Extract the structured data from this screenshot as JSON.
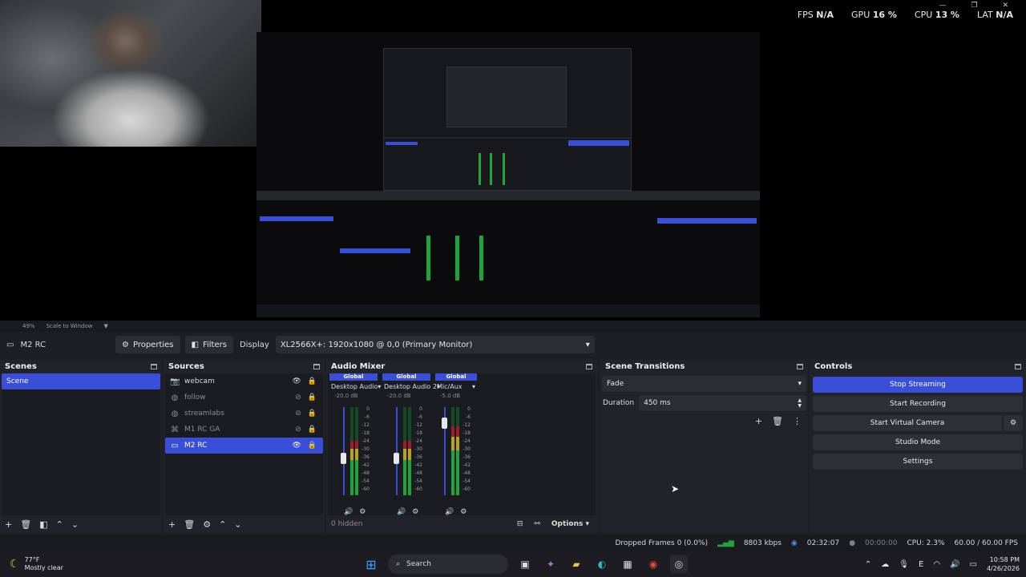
{
  "hud": {
    "fps_label": "FPS",
    "fps_value": "N/A",
    "gpu_label": "GPU",
    "gpu_value": "16 %",
    "cpu_label": "CPU",
    "cpu_value": "13 %",
    "lat_label": "LAT",
    "lat_value": "N/A"
  },
  "scale_row": {
    "zoom": "49%",
    "mode": "Scale to Window"
  },
  "context": {
    "source_name": "M2 RC",
    "properties_label": "Properties",
    "filters_label": "Filters",
    "display_label": "Display",
    "display_value": "XL2566X+: 1920x1080 @ 0,0 (Primary Monitor)"
  },
  "scenes": {
    "title": "Scenes",
    "items": [
      {
        "label": "Scene",
        "selected": true
      }
    ]
  },
  "sources": {
    "title": "Sources",
    "items": [
      {
        "label": "webcam",
        "icon": "camera-icon",
        "visible": true
      },
      {
        "label": "follow",
        "icon": "globe-icon",
        "visible": false
      },
      {
        "label": "streamlabs",
        "icon": "globe-icon",
        "visible": false
      },
      {
        "label": "M1 RC GA",
        "icon": "gamepad-icon",
        "visible": false
      },
      {
        "label": "M2 RC",
        "icon": "monitor-icon",
        "visible": true,
        "selected": true
      }
    ]
  },
  "audio_mixer": {
    "title": "Audio Mixer",
    "channels": [
      {
        "badge": "Global",
        "name": "Desktop Audio",
        "db": "-20.0 dB",
        "level": 0.62,
        "fader": 0.42
      },
      {
        "badge": "Global",
        "name": "Desktop Audio 2",
        "db": "-20.0 dB",
        "level": 0.62,
        "fader": 0.42
      },
      {
        "badge": "Global",
        "name": "Mic/Aux",
        "db": "-5.0 dB",
        "level": 0.78,
        "fader": 0.82
      }
    ],
    "scale_ticks": [
      "0",
      "-6",
      "-12",
      "-18",
      "-24",
      "-30",
      "-36",
      "-42",
      "-48",
      "-54",
      "-60"
    ],
    "hidden_label": "0 hidden",
    "options_label": "Options"
  },
  "transitions": {
    "title": "Scene Transitions",
    "transition": "Fade",
    "duration_label": "Duration",
    "duration_value": "450 ms"
  },
  "controls": {
    "title": "Controls",
    "stop_streaming": "Stop Streaming",
    "start_recording": "Start Recording",
    "start_virtual_camera": "Start Virtual Camera",
    "studio_mode": "Studio Mode",
    "settings": "Settings"
  },
  "status": {
    "dropped_frames": "Dropped Frames 0 (0.0%)",
    "bitrate": "8803 kbps",
    "stream_time": "02:32:07",
    "record_time": "00:00:00",
    "cpu": "CPU: 2.3%",
    "fps": "60.00 / 60.00 FPS"
  },
  "taskbar": {
    "temp": "77°F",
    "weather": "Mostly clear",
    "search_placeholder": "Search",
    "time": "10:58 PM",
    "date": "4/26/2026"
  },
  "colors": {
    "accent": "#3a4fd8",
    "meter_green": "#1fa43b",
    "meter_yellow": "#b9a417",
    "meter_red": "#9e1d2b"
  }
}
